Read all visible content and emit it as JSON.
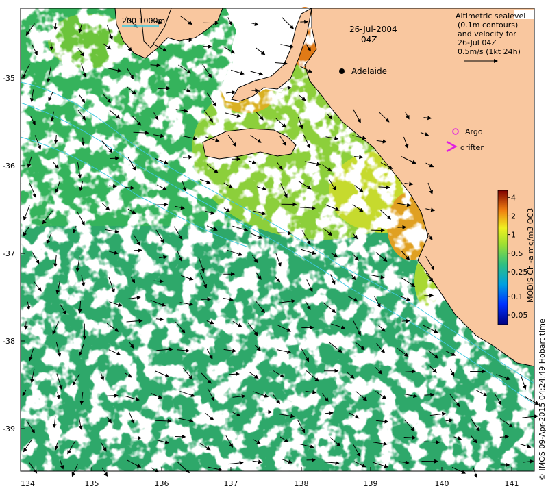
{
  "chart_data": {
    "type": "map",
    "x_ticks": [
      "134",
      "135",
      "136",
      "137",
      "138",
      "139",
      "140",
      "141"
    ],
    "y_ticks": [
      "-35",
      "-36",
      "-37",
      "-38",
      "-39"
    ],
    "date_label": "26-Jul-2004",
    "time_label": "04Z",
    "depth_legend": "200  1000m",
    "city": "Adelaide",
    "velocity_note": [
      "Altimetric sealevel",
      "(0.1m contours)",
      "and velocity for",
      "26-Jul 04Z",
      "0.5m/s (1kt 24h)"
    ],
    "argo_label": "Argo",
    "drifter_label": "drifter",
    "colorbar_title": "MODIS Chl-a mg/m3 OC3",
    "colorbar_ticks": [
      "4",
      "2",
      "1",
      "0.5",
      "0.25",
      "0.1",
      "0.05"
    ],
    "credit": "© IMOS 09-Apr-2015 04:24:49 Hobart time"
  },
  "colors": {
    "land": "#f9c79f",
    "coast": "#000000",
    "chl_high": "#e05a10",
    "chl_mid": "#a8d830",
    "chl_low": "#2eae5a",
    "isobath": "#40c8e0",
    "argo": "#e020e0"
  }
}
